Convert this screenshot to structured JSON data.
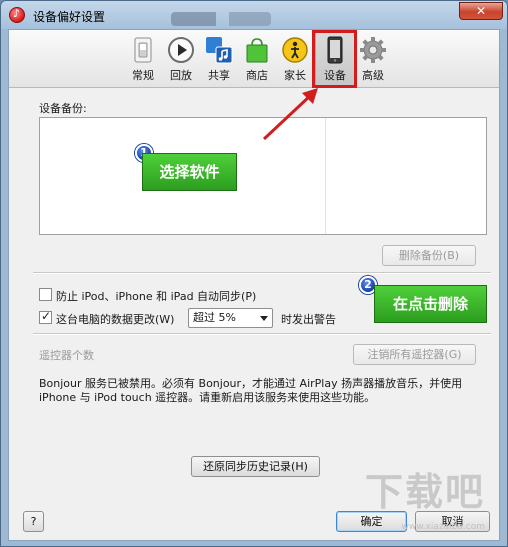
{
  "window": {
    "title": "设备偏好设置",
    "close_glyph": "✕"
  },
  "toolbar": {
    "items": [
      {
        "label": "常规",
        "icon": "general-switch-icon"
      },
      {
        "label": "回放",
        "icon": "playback-icon"
      },
      {
        "label": "共享",
        "icon": "sharing-icon"
      },
      {
        "label": "商店",
        "icon": "store-bag-icon"
      },
      {
        "label": "家长",
        "icon": "parental-icon"
      },
      {
        "label": "设备",
        "icon": "device-icon"
      },
      {
        "label": "高级",
        "icon": "gear-icon"
      }
    ],
    "selected": "设备"
  },
  "backup": {
    "section_label": "设备备份:",
    "delete_button": "删除备份(B)"
  },
  "sync": {
    "prevent_sync_label": "防止 iPod、iPhone 和 iPad 自动同步(P)",
    "prevent_sync_checked": false,
    "data_change_label": "这台电脑的数据更改(W)",
    "data_change_checked": true,
    "threshold_value": "超过 5%",
    "warning_suffix": "时发出警告"
  },
  "remote": {
    "section_label": "遥控器个数",
    "unregister_button": "注销所有遥控器(G)",
    "bonjour_notice_line1": "Bonjour 服务已被禁用。必须有 Bonjour，才能通过 AirPlay 扬声器播放音乐，并使用",
    "bonjour_notice_line2": "iPhone 与 iPod touch 遥控器。请重新启用该服务来使用这些功能。"
  },
  "history": {
    "reset_button": "还原同步历史记录(H)"
  },
  "footer": {
    "help_button": "?",
    "ok_button": "确定",
    "cancel_button": "取消"
  },
  "annotations": {
    "step1_number": "1",
    "step1_text": "选择软件",
    "step2_number": "2",
    "step2_text": "在点击删除",
    "arrow_color": "#d11d1d",
    "highlight_color": "#d11d1d"
  },
  "watermark": {
    "text": "下载吧",
    "url": "www.xiazaiba.com"
  },
  "colors": {
    "frame_blue": "#9fb9d3",
    "client_bg": "#f0f0f0",
    "green_label": "#2c9e1e",
    "badge_blue": "#1740a8"
  }
}
